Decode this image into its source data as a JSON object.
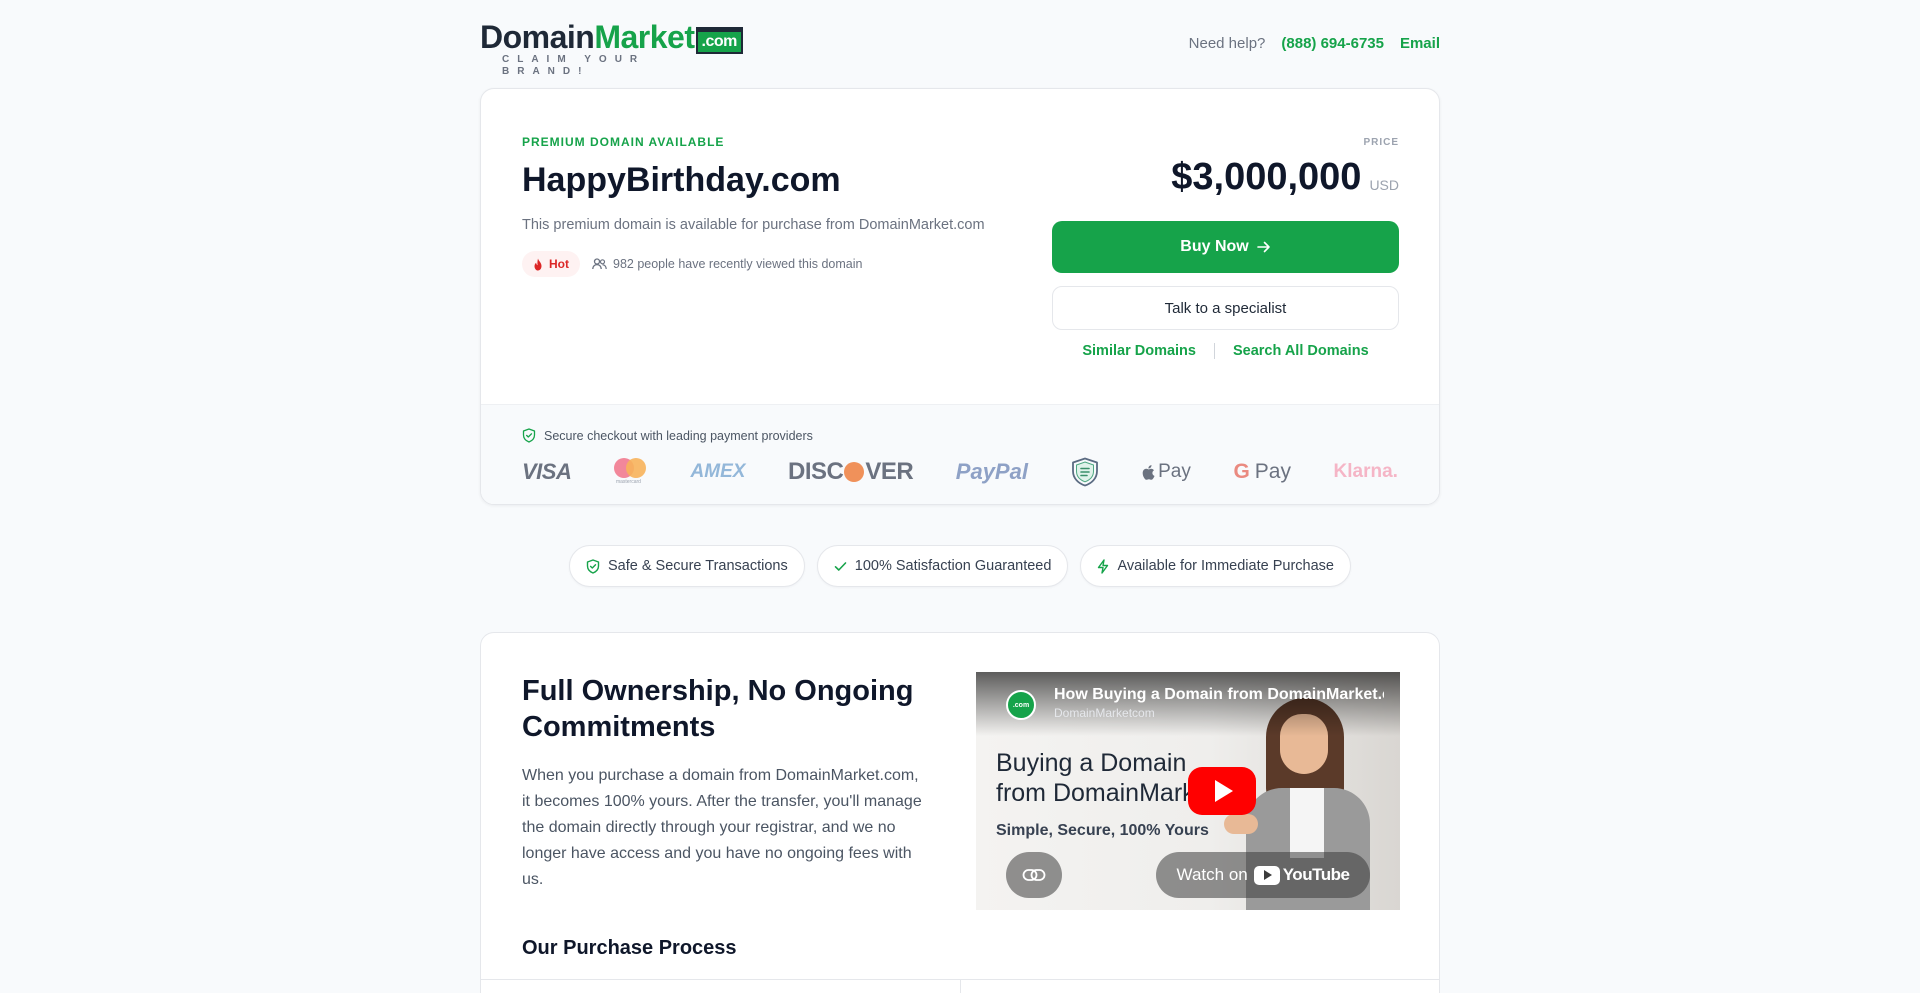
{
  "header": {
    "logo_domain": "Domain",
    "logo_market": "Market",
    "logo_com": ".com",
    "logo_tagline": "CLAIM YOUR BRAND!",
    "help_label": "Need help?",
    "phone": "(888) 694-6735",
    "email_label": "Email"
  },
  "listing": {
    "premium_label": "PREMIUM DOMAIN AVAILABLE",
    "domain": "HappyBirthday.com",
    "description": "This premium domain is available for purchase from DomainMarket.com",
    "hot_label": "Hot",
    "viewers_text": "982 people have recently viewed this domain",
    "price_label": "PRICE",
    "price": "$3,000,000",
    "currency": "USD",
    "buy_label": "Buy Now",
    "talk_label": "Talk to a specialist",
    "similar_label": "Similar Domains",
    "search_label": "Search All Domains"
  },
  "payments": {
    "secure_text": "Secure checkout with leading payment providers",
    "visa": "VISA",
    "mastercard_small": "mastercard",
    "amex": "AMEX",
    "discover_pre": "DISC",
    "discover_post": "VER",
    "paypal": "PayPal",
    "apple_pay": "Pay",
    "google_pay_g": "G",
    "google_pay": "Pay",
    "klarna": "Klarna."
  },
  "trust": [
    {
      "label": "Safe & Secure Transactions",
      "icon": "shield-check-icon"
    },
    {
      "label": "100% Satisfaction Guaranteed",
      "icon": "check-icon"
    },
    {
      "label": "Available for Immediate Purchase",
      "icon": "lightning-icon"
    }
  ],
  "ownership": {
    "title": "Full Ownership, No Ongoing Commitments",
    "text": "When you purchase a domain from DomainMarket.com, it becomes 100% yours. After the transfer, you'll manage the domain directly through your registrar, and we no longer have access and you have no ongoing fees with us.",
    "process_title": "Our Purchase Process"
  },
  "video": {
    "title": "How Buying a Domain from DomainMarket.com Works",
    "channel": "DomainMarketcom",
    "avatar_text": ".com",
    "headline": "Buying a Domain from DomainMarket",
    "subline": "Simple, Secure, 100% Yours",
    "watch_on": "Watch on",
    "youtube": "YouTube"
  },
  "colors": {
    "accent": "#16a34a",
    "hot": "#dc2626",
    "youtube_red": "#ff0000"
  }
}
